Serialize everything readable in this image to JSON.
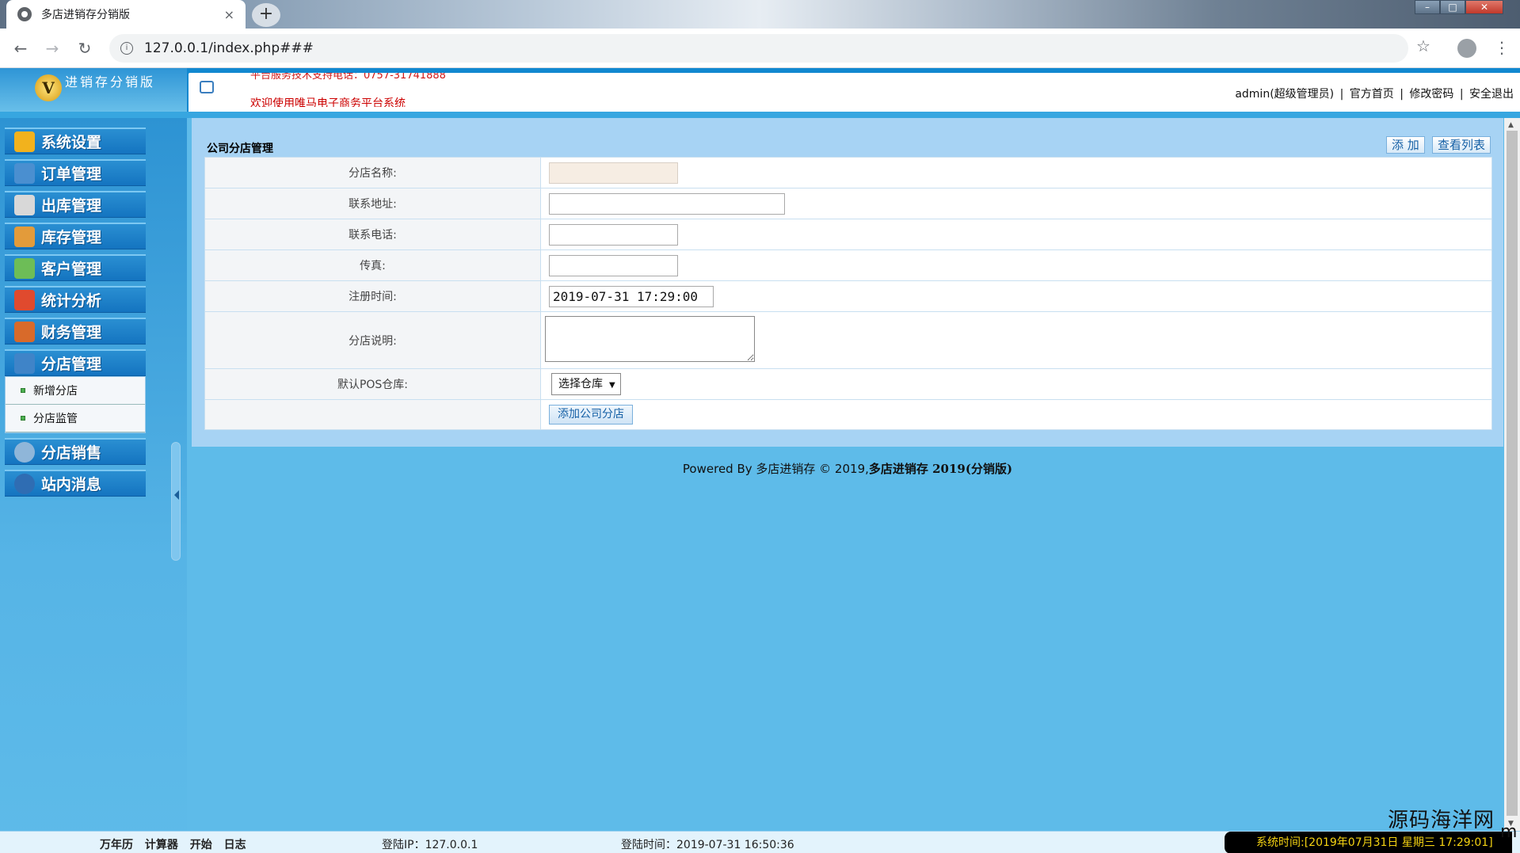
{
  "browser": {
    "tab_title": "多店进销存分销版",
    "tab_close": "×",
    "new_tab": "+",
    "url": "127.0.0.1/index.php###",
    "back": "←",
    "forward": "→",
    "reload": "↻",
    "star": "☆",
    "menu": "⋮"
  },
  "header": {
    "logo_text": "进销存分销版",
    "logo_letter": "V",
    "marquee_top": "平台服务技术支持电话：0757-31741888",
    "marquee": "欢迎使用唯马电子商务平台系统",
    "user": "admin(超级管理员)",
    "links": [
      "官方首页",
      "修改密码",
      "安全退出"
    ],
    "separator": "|"
  },
  "sidebar": {
    "items": [
      {
        "label": "系统设置",
        "icon": "wrench-icon",
        "color": "#f2b21d"
      },
      {
        "label": "订单管理",
        "icon": "computer-icon",
        "color": "#4a8fd0"
      },
      {
        "label": "出库管理",
        "icon": "building-icon",
        "color": "#d8d8d8"
      },
      {
        "label": "库存管理",
        "icon": "truck-icon",
        "color": "#e39b3a"
      },
      {
        "label": "客户管理",
        "icon": "contacts-icon",
        "color": "#6dbd57"
      },
      {
        "label": "统计分析",
        "icon": "barchart-icon",
        "color": "#e04a2e"
      },
      {
        "label": "财务管理",
        "icon": "ledger-icon",
        "color": "#d86a2a"
      },
      {
        "label": "分店管理",
        "icon": "branch-icon",
        "color": "#3f84c8"
      },
      {
        "label": "分店销售",
        "icon": "gear-icon",
        "color": "#8fb6d9"
      },
      {
        "label": "站内消息",
        "icon": "info-icon",
        "color": "#2f6db3"
      }
    ],
    "submenu": [
      "新增分店",
      "分店监管"
    ]
  },
  "main": {
    "title": "公司分店管理",
    "add_button": "添 加",
    "list_button": "查看列表",
    "form": {
      "name_label": "分店名称:",
      "name_value": "",
      "address_label": "联系地址:",
      "address_value": "",
      "phone_label": "联系电话:",
      "phone_value": "",
      "fax_label": "传真:",
      "fax_value": "",
      "regtime_label": "注册时间:",
      "regtime_value": "2019-07-31 17:29:00",
      "desc_label": "分店说明:",
      "desc_value": "",
      "pos_label": "默认POS仓库:",
      "pos_selected": "选择仓库",
      "submit_label": "添加公司分店"
    }
  },
  "footer": {
    "powered_prefix": "Powered By 多店进销存 © 2019,",
    "powered_bold": "多店进销存 2019(分销版)"
  },
  "statusbar": {
    "tools": [
      "万年历",
      "计算器",
      "开始",
      "日志"
    ],
    "login_ip": "登陆IP：127.0.0.1",
    "login_time": "登陆时间：2019-07-31 16:50:36",
    "system_time": "系统时间:[2019年07月31日 星期三 17:29:01]"
  },
  "watermark": "源码海洋网",
  "watermark_tail": "m"
}
